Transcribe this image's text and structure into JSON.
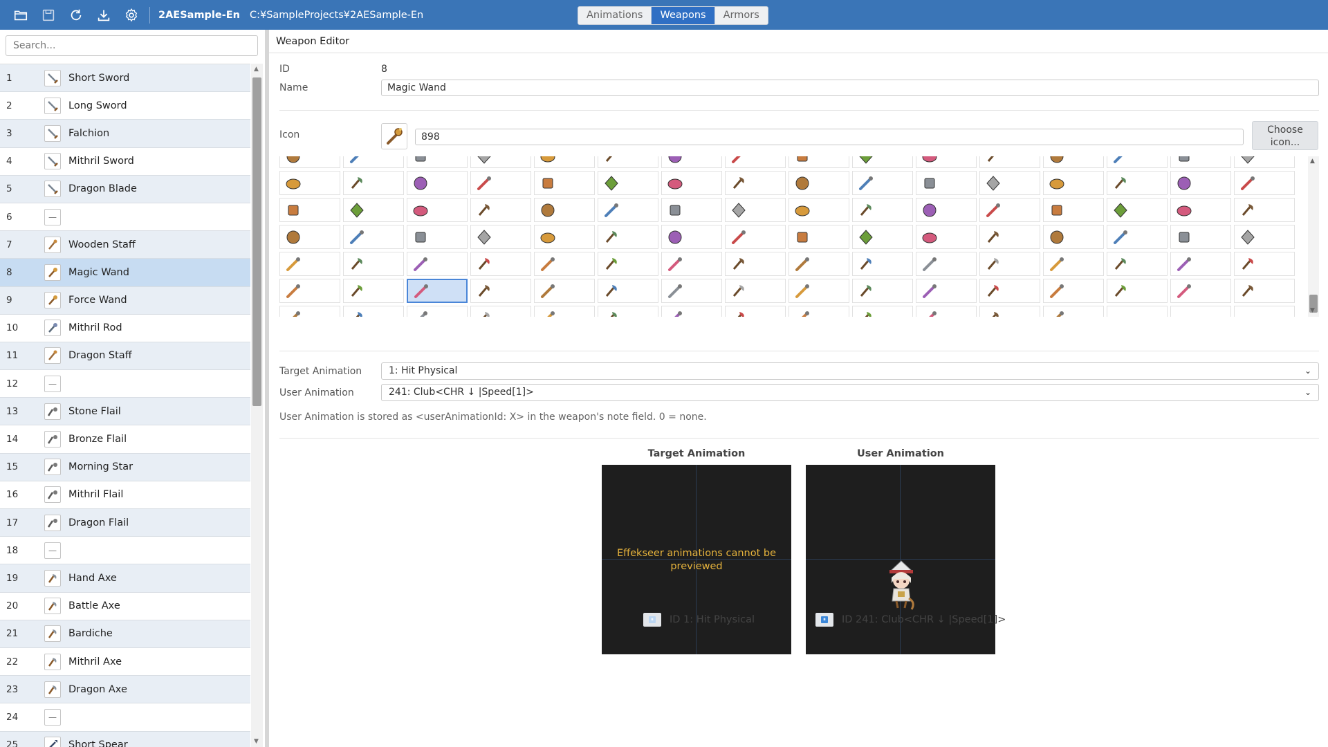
{
  "toolbar": {
    "icons": [
      "folder-open-icon",
      "save-icon",
      "reload-icon",
      "download-icon",
      "gear-icon"
    ],
    "project_name": "2AESample-En",
    "project_path": "C:¥SampleProjects¥2AESample-En"
  },
  "tabs": [
    {
      "label": "Animations",
      "active": false
    },
    {
      "label": "Weapons",
      "active": true
    },
    {
      "label": "Armors",
      "active": false
    }
  ],
  "sidebar": {
    "search_placeholder": "Search...",
    "items": [
      {
        "id": "1",
        "name": "Short Sword",
        "icon": "sword-icon"
      },
      {
        "id": "2",
        "name": "Long Sword",
        "icon": "sword-icon"
      },
      {
        "id": "3",
        "name": "Falchion",
        "icon": "sword-icon"
      },
      {
        "id": "4",
        "name": "Mithril Sword",
        "icon": "sword-icon"
      },
      {
        "id": "5",
        "name": "Dragon Blade",
        "icon": "sword-icon"
      },
      {
        "id": "6",
        "name": "",
        "icon": "empty-icon"
      },
      {
        "id": "7",
        "name": "Wooden Staff",
        "icon": "staff-icon"
      },
      {
        "id": "8",
        "name": "Magic Wand",
        "icon": "wand-icon"
      },
      {
        "id": "9",
        "name": "Force Wand",
        "icon": "wand-icon"
      },
      {
        "id": "10",
        "name": "Mithril Rod",
        "icon": "rod-icon"
      },
      {
        "id": "11",
        "name": "Dragon Staff",
        "icon": "staff-icon"
      },
      {
        "id": "12",
        "name": "",
        "icon": "empty-icon"
      },
      {
        "id": "13",
        "name": "Stone Flail",
        "icon": "flail-icon"
      },
      {
        "id": "14",
        "name": "Bronze Flail",
        "icon": "flail-icon"
      },
      {
        "id": "15",
        "name": "Morning Star",
        "icon": "flail-icon"
      },
      {
        "id": "16",
        "name": "Mithril Flail",
        "icon": "flail-icon"
      },
      {
        "id": "17",
        "name": "Dragon Flail",
        "icon": "flail-icon"
      },
      {
        "id": "18",
        "name": "",
        "icon": "empty-icon"
      },
      {
        "id": "19",
        "name": "Hand Axe",
        "icon": "axe-icon"
      },
      {
        "id": "20",
        "name": "Battle Axe",
        "icon": "axe-icon"
      },
      {
        "id": "21",
        "name": "Bardiche",
        "icon": "axe-icon"
      },
      {
        "id": "22",
        "name": "Mithril Axe",
        "icon": "axe-icon"
      },
      {
        "id": "23",
        "name": "Dragon Axe",
        "icon": "axe-icon"
      },
      {
        "id": "24",
        "name": "",
        "icon": "empty-icon"
      },
      {
        "id": "25",
        "name": "Short Spear",
        "icon": "spear-icon"
      }
    ],
    "selected_id": "8",
    "empty_glyph": "—"
  },
  "editor": {
    "title": "Weapon Editor",
    "id_label": "ID",
    "id_value": "8",
    "name_label": "Name",
    "name_value": "Magic Wand",
    "icon_label": "Icon",
    "icon_value": "898",
    "choose_icon_label": "Choose icon...",
    "target_animation_label": "Target Animation",
    "target_animation_value": "1: Hit Physical",
    "user_animation_label": "User Animation",
    "user_animation_value": "241: Club<CHR ↓ |Speed[1]>",
    "note": "User Animation is stored as <userAnimationId: X> in the weapon's note field. 0 = none."
  },
  "icon_grid": {
    "selected_index": 2,
    "colors": [
      "#b07a3c",
      "#c94a4a",
      "#8a8f96",
      "#6c9e3a",
      "#d79a3b",
      "#7a5a3a",
      "#9c5fb5",
      "#4e7fb8",
      "#c87c3f",
      "#a5a5a5",
      "#d45a7d",
      "#5c8a5c"
    ]
  },
  "preview": {
    "target_title": "Target Animation",
    "user_title": "User Animation",
    "effekseer_msg": "Effekseer animations cannot be previewed",
    "target_caption": "ID 1: Hit Physical",
    "user_caption": "ID 241: Club<CHR ↓ |Speed[1]>",
    "play_glyph": "⏸",
    "accent": "#3a75b7"
  }
}
